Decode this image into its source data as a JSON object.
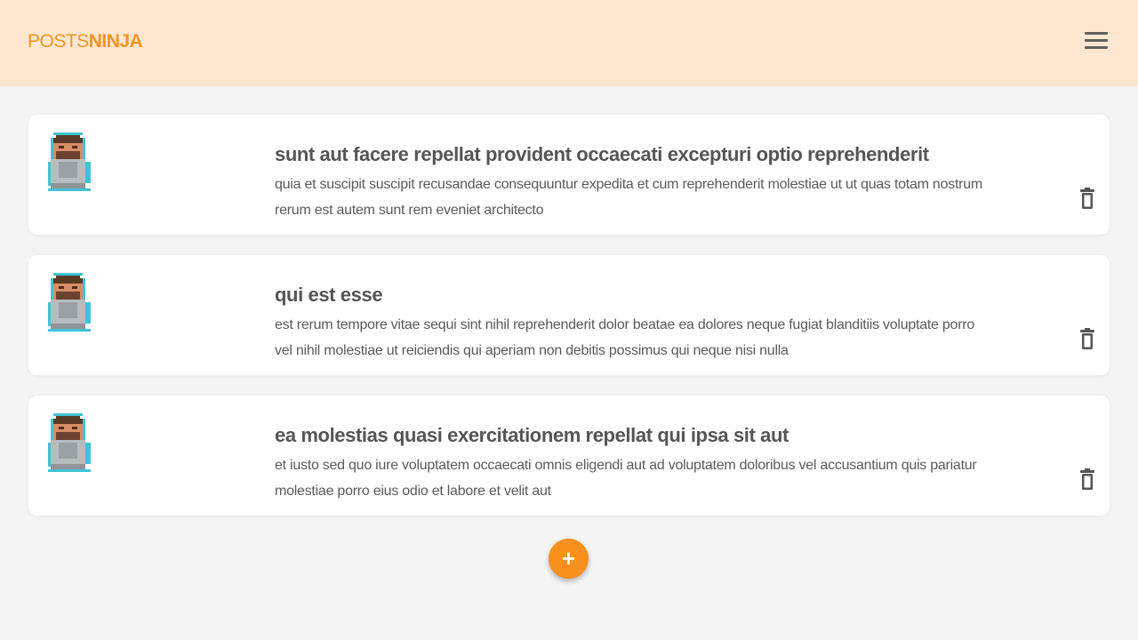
{
  "header": {
    "brand_regular": "POSTS",
    "brand_bold": "NINJA",
    "menu_icon": "hamburger-menu-icon"
  },
  "posts": [
    {
      "title": "sunt aut facere repellat provident occaecati excepturi optio reprehenderit",
      "body": "quia et suscipit suscipit recusandae consequuntur expedita et cum reprehenderit molestiae ut ut quas totam nostrum rerum est autem sunt rem eveniet architecto",
      "avatar_icon": "pixel-avatar-icon",
      "delete_icon": "trash-icon"
    },
    {
      "title": "qui est esse",
      "body": "est rerum tempore vitae sequi sint nihil reprehenderit dolor beatae ea dolores neque fugiat blanditiis voluptate porro vel nihil molestiae ut reiciendis qui aperiam non debitis possimus qui neque nisi nulla",
      "avatar_icon": "pixel-avatar-icon",
      "delete_icon": "trash-icon"
    },
    {
      "title": "ea molestias quasi exercitationem repellat qui ipsa sit aut",
      "body": "et iusto sed quo iure voluptatem occaecati omnis eligendi aut ad voluptatem doloribus vel accusantium quis pariatur molestiae porro eius odio et labore et velit aut",
      "avatar_icon": "pixel-avatar-icon",
      "delete_icon": "trash-icon"
    }
  ],
  "fab": {
    "label": "+",
    "icon": "plus-icon"
  },
  "colors": {
    "brand": "#f7931e",
    "header_bg": "#fee7d1",
    "page_bg": "#f4f4f4",
    "card_bg": "#ffffff",
    "fab_bg": "#f98f1d",
    "title_text": "#555555",
    "body_text": "#5a5a5a"
  }
}
